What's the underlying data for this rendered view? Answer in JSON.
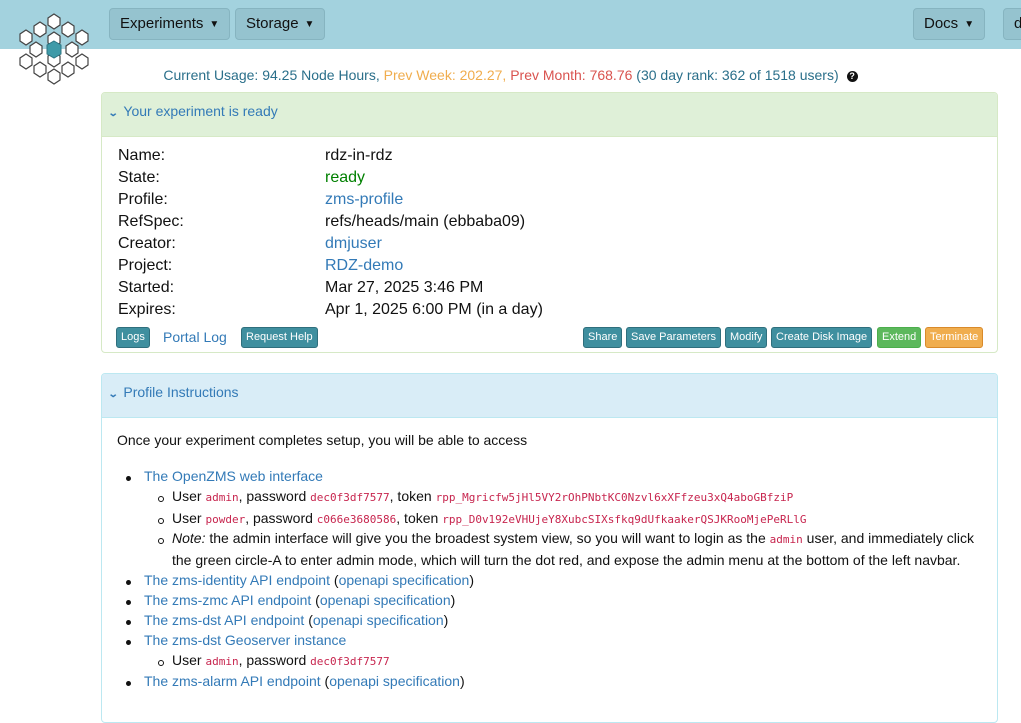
{
  "nav": {
    "experiments": "Experiments",
    "storage": "Storage",
    "docs": "Docs",
    "user_partial": "d"
  },
  "usage": {
    "current": "Current Usage: 94.25 Node Hours,",
    "prev_week": "Prev Week: 202.27,",
    "prev_month": "Prev Month: 768.76",
    "rank": "(30 day rank: 362 of 1518 users)",
    "help_glyph": "?"
  },
  "experiment_panel": {
    "title": "Your experiment is ready",
    "rows": [
      {
        "label": "Name:",
        "value": "rdz-in-rdz"
      },
      {
        "label": "State:",
        "value": "ready"
      },
      {
        "label": "Profile:",
        "value": "zms-profile"
      },
      {
        "label": "RefSpec:",
        "value": "refs/heads/main (ebbaba09)"
      },
      {
        "label": "Creator:",
        "value": "dmjuser"
      },
      {
        "label": "Project:",
        "value": "RDZ-demo"
      },
      {
        "label": "Started:",
        "value": "Mar 27, 2025 3:46 PM"
      },
      {
        "label": "Expires:",
        "value": "Apr 1, 2025 6:00 PM (in a day)"
      }
    ],
    "buttons": {
      "logs": "Logs",
      "portal_log": "Portal Log",
      "request_help": "Request Help",
      "share": "Share",
      "save_parameters": "Save Parameters",
      "modify": "Modify",
      "create_disk_image": "Create Disk Image",
      "extend": "Extend",
      "terminate": "Terminate"
    }
  },
  "instructions_panel": {
    "title": "Profile Instructions",
    "intro": "Once your experiment completes setup, you will be able to access",
    "web_interface": "The OpenZMS web interface",
    "user_word": "User",
    "password_word": ", password",
    "token_word": ", token",
    "admin_user": "admin",
    "admin_password": "dec0f3df7577",
    "admin_token": "rpp_Mgricfw5jHl5VY2rOhPNbtKC0Nzvl6xXFfzeu3xQ4aboGBfziP",
    "powder_user": "powder",
    "powder_password": "c066e3680586",
    "powder_token": "rpp_D0v192eVHUjeY8XubcSIXsfkq9dUfkaakerQSJKRooMjePeRLlG",
    "note_label": "Note:",
    "note_text_1": " the admin interface will give you the broadest system view, so you will want to login as the ",
    "note_admin": "admin",
    "note_text_2": " user, and immediately click",
    "note_text_3": "the green circle-A to enter admin mode, which will turn the dot red, and expose the admin menu at the bottom of the left navbar.",
    "identity": "The zms-identity API endpoint",
    "zmc": "The zms-zmc API endpoint",
    "dst": "The zms-dst API endpoint",
    "geoserver": "The zms-dst Geoserver instance",
    "alarm": "The zms-alarm API endpoint",
    "openapi": "openapi specification",
    "open_paren": " (",
    "close_paren": ")",
    "geo_user": "admin",
    "geo_password": "dec0f3df7577"
  }
}
